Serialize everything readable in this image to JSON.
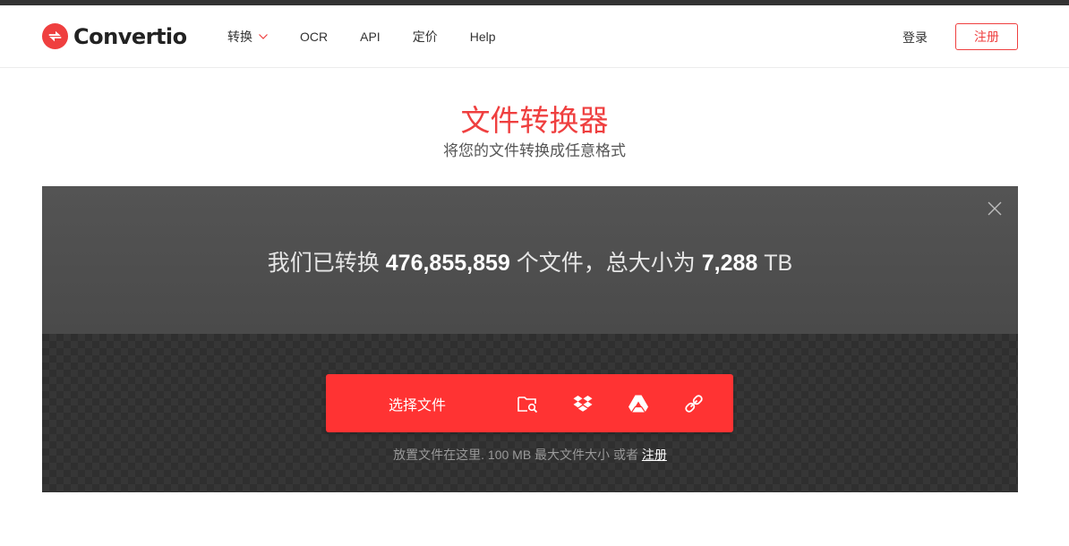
{
  "brand": {
    "name": "Convertio",
    "accent": "#ef3f3f"
  },
  "nav": {
    "items": [
      {
        "label": "转换",
        "has_dropdown": true
      },
      {
        "label": "OCR"
      },
      {
        "label": "API"
      },
      {
        "label": "定价"
      },
      {
        "label": "Help"
      }
    ]
  },
  "auth": {
    "login_label": "登录",
    "signup_label": "注册"
  },
  "hero": {
    "title": "文件转换器",
    "subtitle": "将您的文件转换成任意格式"
  },
  "stats": {
    "prefix": "我们已转换",
    "files_count": "476,855,859",
    "files_unit": "个文件，总大小为",
    "total_size": "7,288",
    "size_unit": "TB"
  },
  "upload": {
    "choose_label": "选择文件",
    "sources": [
      "folder-search-icon",
      "dropbox-icon",
      "google-drive-icon",
      "link-icon"
    ],
    "hint_text": "放置文件在这里. 100 MB 最大文件大小 或者",
    "hint_link": "注册"
  },
  "colors": {
    "upload_button": "#ff3333",
    "panel_top": "#4f4f4f",
    "panel_bottom": "#2f2f2f"
  }
}
